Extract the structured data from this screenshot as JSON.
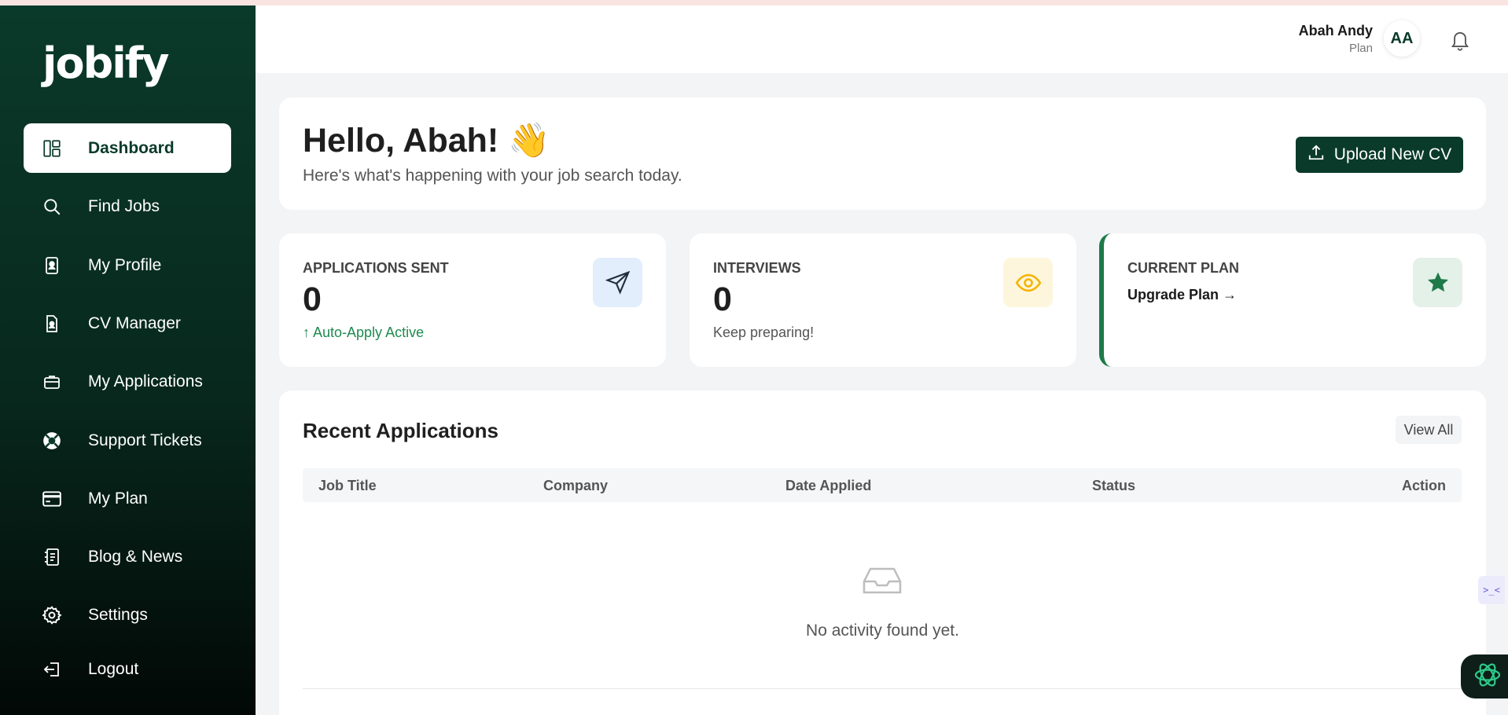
{
  "brand": {
    "logo_text": "jobify"
  },
  "sidebar": {
    "items": [
      {
        "label": "Dashboard",
        "icon": "dashboard-icon",
        "active": true
      },
      {
        "label": "Find Jobs",
        "icon": "search-icon"
      },
      {
        "label": "My Profile",
        "icon": "profile-icon"
      },
      {
        "label": "CV Manager",
        "icon": "document-icon"
      },
      {
        "label": "My Applications",
        "icon": "briefcase-icon"
      },
      {
        "label": "Support Tickets",
        "icon": "lifebuoy-icon"
      },
      {
        "label": "My Plan",
        "icon": "credit-card-icon"
      },
      {
        "label": "Blog & News",
        "icon": "news-icon"
      },
      {
        "label": "Settings",
        "icon": "gear-icon"
      },
      {
        "label": "Logout",
        "icon": "logout-icon"
      }
    ]
  },
  "topbar": {
    "user_name": "Abah Andy",
    "user_plan": "Plan",
    "avatar_initials": "AA",
    "notification_icon": "bell-icon"
  },
  "hero": {
    "title": "Hello, Abah! 👋",
    "subtitle": "Here's what's happening with your job search today.",
    "upload_button": "Upload New CV"
  },
  "stats": {
    "applications": {
      "label": "APPLICATIONS SENT",
      "value": "0",
      "note": "↑ Auto-Apply Active",
      "icon": "send-icon",
      "icon_bg": "#e3eefc"
    },
    "interviews": {
      "label": "INTERVIEWS",
      "value": "0",
      "note": "Keep preparing!",
      "icon": "eye-icon",
      "icon_bg": "#fdf6dc"
    },
    "plan": {
      "label": "CURRENT PLAN",
      "link": "Upgrade Plan →",
      "icon": "star-icon",
      "icon_bg": "#e4f1e9"
    }
  },
  "recent": {
    "title": "Recent Applications",
    "view_all": "View All",
    "columns": [
      "Job Title",
      "Company",
      "Date Applied",
      "Status",
      "Action"
    ],
    "empty_text": "No activity found yet."
  },
  "colors": {
    "brand_dark": "#0a3a2a",
    "accent_green": "#1e7a49"
  }
}
